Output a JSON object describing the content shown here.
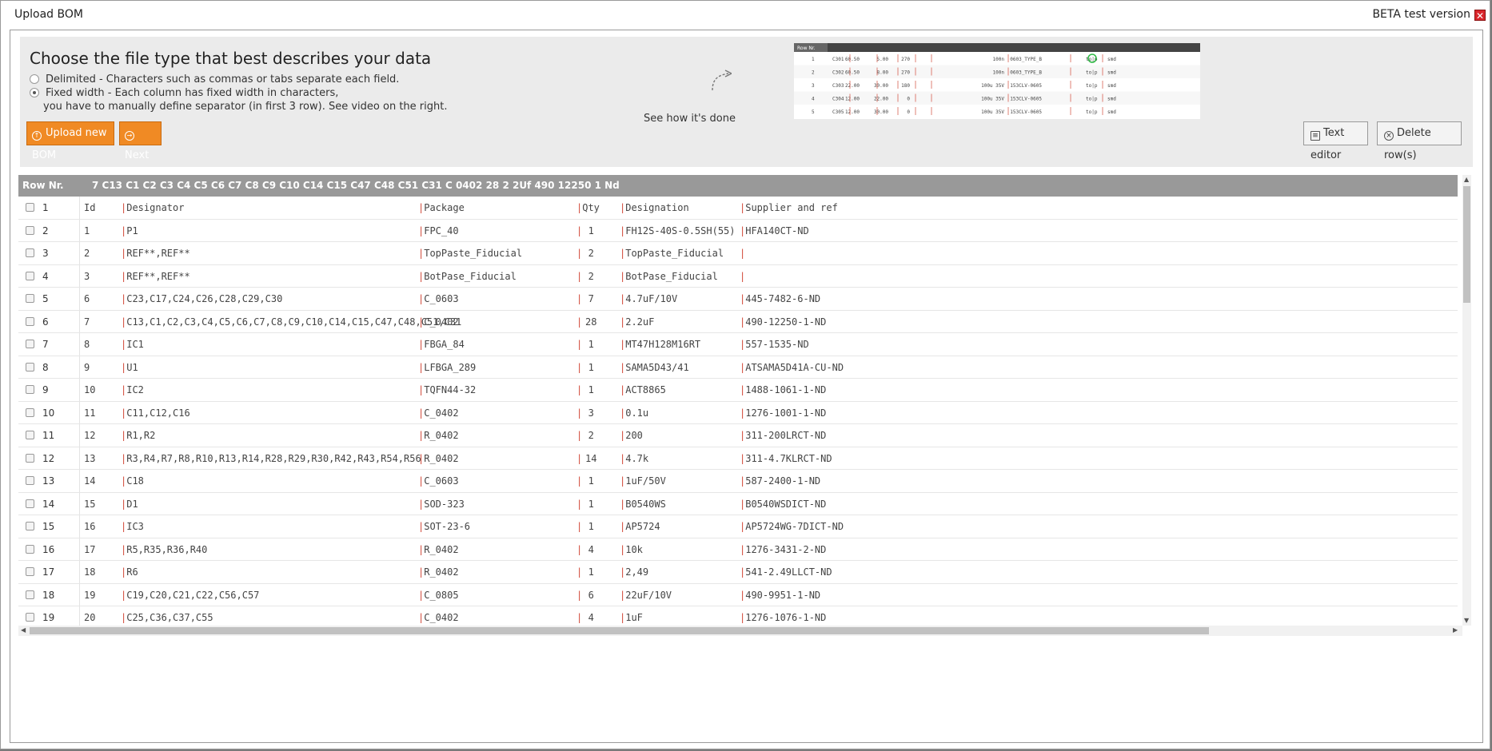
{
  "window": {
    "title": "Upload BOM",
    "beta_label": "BETA test version"
  },
  "options": {
    "heading": "Choose the file type that best describes your data",
    "delimited": "Delimited - Characters such as commas or tabs separate each field.",
    "fixed_line1": "Fixed width - Each column has fixed width in characters,",
    "fixed_line2": "you have to manually define separator (in first 3 row). See video on the right.",
    "selected": "fixed"
  },
  "video_hint": "See how it's done",
  "video_preview": {
    "header": "Row Nr.",
    "rows": [
      {
        "n": "1",
        "ref": "C301",
        "a": "60.50",
        "b": "5.00",
        "c": "270",
        "val": "100n",
        "pkg": "0603_TYPE_B",
        "x": "to|p",
        "y": "smd"
      },
      {
        "n": "2",
        "ref": "C302",
        "a": "60.50",
        "b": "8.00",
        "c": "270",
        "val": "100n",
        "pkg": "0603_TYPE_B",
        "x": "to|p",
        "y": "smd"
      },
      {
        "n": "3",
        "ref": "C303",
        "a": "22.00",
        "b": "30.00",
        "c": "180",
        "val": "100u 35V",
        "pkg": "153CLV-0605",
        "x": "to|p",
        "y": "smd"
      },
      {
        "n": "4",
        "ref": "C304",
        "a": "12.00",
        "b": "22.00",
        "c": "0",
        "val": "100u 35V",
        "pkg": "153CLV-0605",
        "x": "to|p",
        "y": "smd"
      },
      {
        "n": "5",
        "ref": "C305",
        "a": "12.00",
        "b": "30.00",
        "c": "0",
        "val": "100u 35V",
        "pkg": "153CLV-0605",
        "x": "to|p",
        "y": "smd"
      }
    ]
  },
  "buttons": {
    "upload": "Upload new BOM",
    "next": "Next",
    "text_editor": "Text editor",
    "delete_rows": "Delete row(s)"
  },
  "grid": {
    "header_label": "Row Nr.",
    "header_text": "7 C13 C1 C2 C3 C4 C5 C6 C7 C8 C9 C10 C14 C15 C47 C48 C51 C31 C 0402 28 2 2Uf 490 12250 1 Nd",
    "rows": [
      {
        "n": "1",
        "id": "Id",
        "des": "Designator",
        "pkg": "Package",
        "qty": "Qty",
        "val": "Designation",
        "sup": "Supplier and ref"
      },
      {
        "n": "2",
        "id": "1",
        "des": "P1",
        "pkg": "FPC_40",
        "qty": "1",
        "val": "FH12S-40S-0.5SH(55)",
        "sup": "HFA140CT-ND"
      },
      {
        "n": "3",
        "id": "2",
        "des": "REF**,REF**",
        "pkg": "TopPaste_Fiducial",
        "qty": "2",
        "val": "TopPaste_Fiducial",
        "sup": ""
      },
      {
        "n": "4",
        "id": "3",
        "des": "REF**,REF**",
        "pkg": "BotPase_Fiducial",
        "qty": "2",
        "val": "BotPase_Fiducial",
        "sup": ""
      },
      {
        "n": "5",
        "id": "6",
        "des": "C23,C17,C24,C26,C28,C29,C30",
        "pkg": "C_0603",
        "qty": "7",
        "val": "4.7uF/10V",
        "sup": "445-7482-6-ND"
      },
      {
        "n": "6",
        "id": "7",
        "des": "C13,C1,C2,C3,C4,C5,C6,C7,C8,C9,C10,C14,C15,C47,C48,C51,C31",
        "pkg": "C_0402",
        "qty": "28",
        "val": "2.2uF",
        "sup": "490-12250-1-ND"
      },
      {
        "n": "7",
        "id": "8",
        "des": "IC1",
        "pkg": "FBGA_84",
        "qty": "1",
        "val": "MT47H128M16RT",
        "sup": "557-1535-ND"
      },
      {
        "n": "8",
        "id": "9",
        "des": "U1",
        "pkg": "LFBGA_289",
        "qty": "1",
        "val": "SAMA5D43/41",
        "sup": "ATSAMA5D41A-CU-ND"
      },
      {
        "n": "9",
        "id": "10",
        "des": "IC2",
        "pkg": "TQFN44-32",
        "qty": "1",
        "val": "ACT8865",
        "sup": "1488-1061-1-ND"
      },
      {
        "n": "10",
        "id": "11",
        "des": "C11,C12,C16",
        "pkg": "C_0402",
        "qty": "3",
        "val": "0.1u",
        "sup": "1276-1001-1-ND"
      },
      {
        "n": "11",
        "id": "12",
        "des": "R1,R2",
        "pkg": "R_0402",
        "qty": "2",
        "val": "200",
        "sup": "311-200LRCT-ND"
      },
      {
        "n": "12",
        "id": "13",
        "des": "R3,R4,R7,R8,R10,R13,R14,R28,R29,R30,R42,R43,R54,R56",
        "pkg": "R_0402",
        "qty": "14",
        "val": "4.7k",
        "sup": "311-4.7KLRCT-ND"
      },
      {
        "n": "13",
        "id": "14",
        "des": "C18",
        "pkg": "C_0603",
        "qty": "1",
        "val": "1uF/50V",
        "sup": "587-2400-1-ND"
      },
      {
        "n": "14",
        "id": "15",
        "des": "D1",
        "pkg": "SOD-323",
        "qty": "1",
        "val": "B0540WS",
        "sup": "B0540WSDICT-ND"
      },
      {
        "n": "15",
        "id": "16",
        "des": "IC3",
        "pkg": "SOT-23-6",
        "qty": "1",
        "val": "AP5724",
        "sup": "AP5724WG-7DICT-ND"
      },
      {
        "n": "16",
        "id": "17",
        "des": "R5,R35,R36,R40",
        "pkg": "R_0402",
        "qty": "4",
        "val": "10k",
        "sup": "1276-3431-2-ND"
      },
      {
        "n": "17",
        "id": "18",
        "des": "R6",
        "pkg": "R_0402",
        "qty": "1",
        "val": "2,49",
        "sup": "541-2.49LLCT-ND"
      },
      {
        "n": "18",
        "id": "19",
        "des": "C19,C20,C21,C22,C56,C57",
        "pkg": "C_0805",
        "qty": "6",
        "val": "22uF/10V",
        "sup": "490-9951-1-ND"
      },
      {
        "n": "19",
        "id": "20",
        "des": "C25,C36,C37,C55",
        "pkg": "C_0402",
        "qty": "4",
        "val": "1uF",
        "sup": "1276-1076-1-ND"
      }
    ]
  }
}
